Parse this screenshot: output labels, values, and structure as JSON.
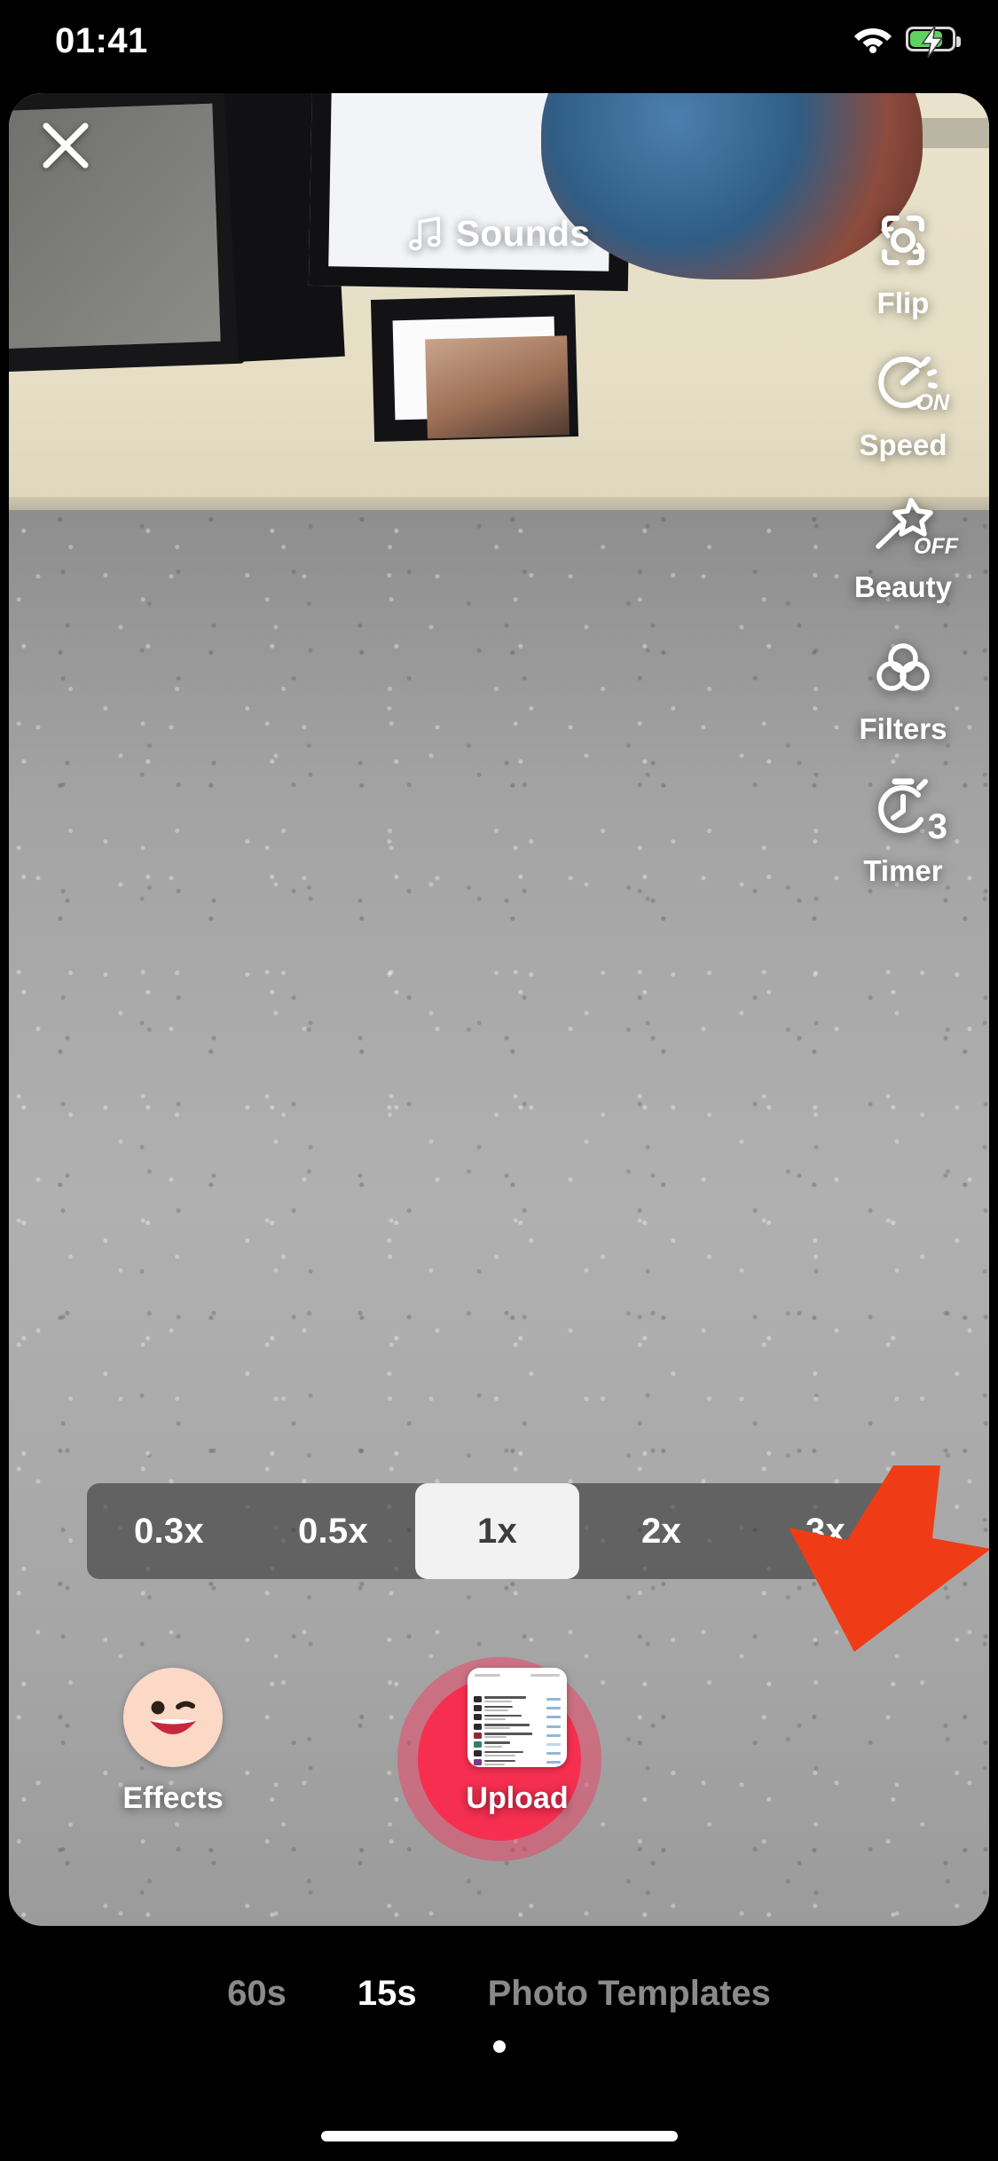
{
  "status_bar": {
    "time": "01:41",
    "wifi_icon": "wifi-icon",
    "battery_icon": "battery-charging-icon",
    "battery_charging": true,
    "battery_color": "#5ED25E"
  },
  "top_bar": {
    "close_label": "×",
    "close_icon": "close-icon",
    "sounds_label": "Sounds",
    "sounds_icon": "music-note-icon"
  },
  "right_tools": [
    {
      "label": "Flip",
      "icon": "camera-flip-icon",
      "badge": ""
    },
    {
      "label": "Speed",
      "icon": "speedometer-icon",
      "badge": "ON"
    },
    {
      "label": "Beauty",
      "icon": "magic-wand-star-icon",
      "badge": "OFF"
    },
    {
      "label": "Filters",
      "icon": "three-circles-icon",
      "badge": ""
    },
    {
      "label": "Timer",
      "icon": "stopwatch-icon",
      "badge": "3"
    }
  ],
  "speed_selector": {
    "options": [
      "0.3x",
      "0.5x",
      "1x",
      "2x",
      "3x"
    ],
    "selected": "1x"
  },
  "annotation": {
    "arrow_color": "#F03C16",
    "arrow_name": "red-arrow-pointing-at-upload"
  },
  "bottom_controls": {
    "effects_label": "Effects",
    "effects_icon": "winking-smiley-icon",
    "record_label": "",
    "record_icon": "record-button",
    "record_color": "#F62F51",
    "upload_label": "Upload",
    "upload_icon": "gallery-thumbnail"
  },
  "mode_tabs": {
    "items": [
      {
        "label": "60s",
        "active": false
      },
      {
        "label": "15s",
        "active": true
      },
      {
        "label": "Photo Templates",
        "active": false
      }
    ],
    "selected": "15s"
  },
  "system": {
    "home_indicator": "home-indicator"
  }
}
